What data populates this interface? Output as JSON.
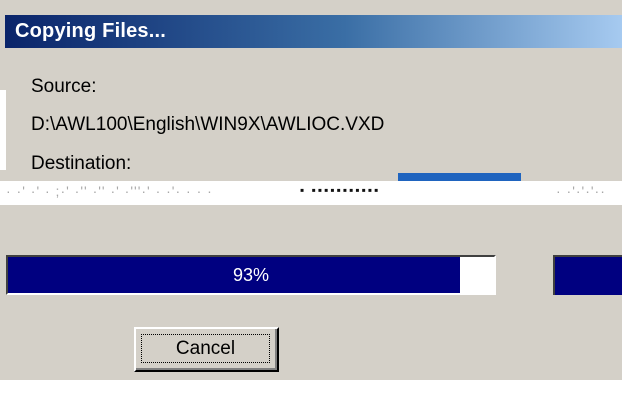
{
  "window": {
    "title": "Copying Files..."
  },
  "copy": {
    "source_label": "Source:",
    "source_path": "D:\\AWL100\\English\\WIN9X\\AWLIOC.VXD",
    "destination_label": "Destination:"
  },
  "progress": {
    "label": "93%",
    "fraction": 0.93,
    "secondary_fraction": 1.0
  },
  "buttons": {
    "cancel_label": "Cancel"
  },
  "colors": {
    "progress_fill": "#000080",
    "title_start": "#0a246a",
    "title_end": "#a6caf0",
    "face": "#d4d0c8"
  }
}
